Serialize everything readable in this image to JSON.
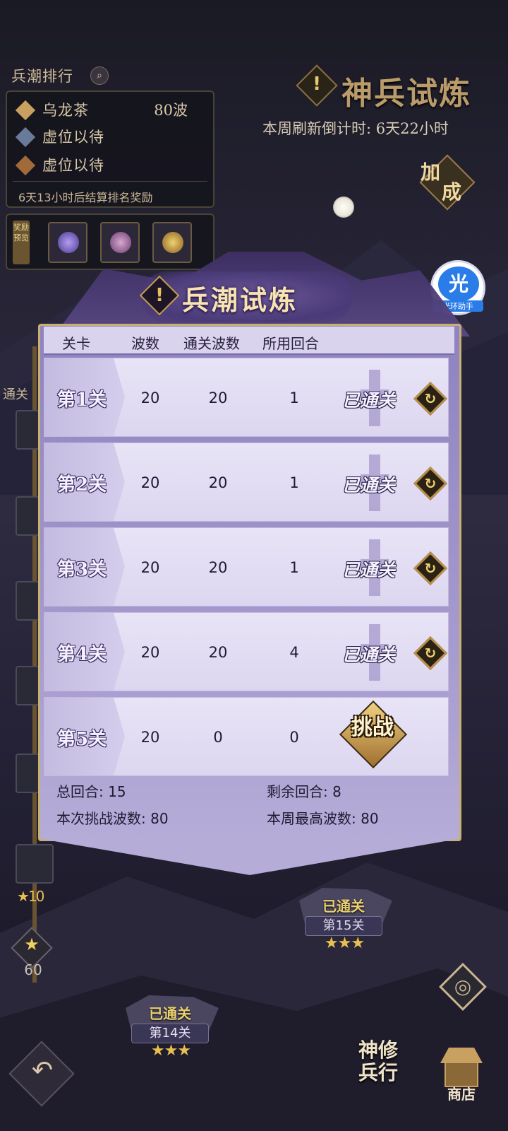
{
  "ranking": {
    "title": "兵潮排行",
    "entries": [
      {
        "name": "乌龙茶",
        "score": "80波",
        "badge_color": "#c8a060"
      },
      {
        "name": "虚位以待",
        "score": "",
        "badge_color": "#6a7a9a"
      },
      {
        "name": "虚位以待",
        "score": "",
        "badge_color": "#a06a3a"
      }
    ],
    "footer": "6天13小时后结算排名奖励",
    "reward_label": "奖励预览"
  },
  "event": {
    "title": "神兵试炼",
    "countdown": "本周刷新倒计时: 6天22小时",
    "bonus_label_1": "加",
    "bonus_label_2": "成"
  },
  "helper": {
    "glyph": "光",
    "label": "光环助手"
  },
  "dialog": {
    "title": "兵潮试炼",
    "columns": [
      "关卡",
      "波数",
      "通关波数",
      "所用回合"
    ],
    "rows": [
      {
        "label": "第1关",
        "waves": "20",
        "cleared": "20",
        "rounds": "1",
        "status": "已通关"
      },
      {
        "label": "第2关",
        "waves": "20",
        "cleared": "20",
        "rounds": "1",
        "status": "已通关"
      },
      {
        "label": "第3关",
        "waves": "20",
        "cleared": "20",
        "rounds": "1",
        "status": "已通关"
      },
      {
        "label": "第4关",
        "waves": "20",
        "cleared": "20",
        "rounds": "4",
        "status": "已通关"
      },
      {
        "label": "第5关",
        "waves": "20",
        "cleared": "0",
        "rounds": "0",
        "status": "挑战"
      }
    ],
    "summary": {
      "total_rounds": "总回合: 15",
      "remaining_rounds": "剩余回合: 8",
      "current_waves": "本次挑战波数: 80",
      "weekly_best": "本周最高波数: 80"
    }
  },
  "map": {
    "left_partial": "通关",
    "side_star_count_1": "10",
    "side_star_count_2": "60",
    "node_15": {
      "status": "已通关",
      "level": "第15关",
      "stars": "★★★"
    },
    "node_14": {
      "status": "已通关",
      "level": "第14关",
      "stars": "★★★"
    }
  },
  "nav": {
    "cultivate_line1": "神修",
    "cultivate_line2": "兵行",
    "shop": "商店"
  },
  "colors": {
    "accent_gold": "#c8a050",
    "dialog_purple": "#a59acd"
  }
}
